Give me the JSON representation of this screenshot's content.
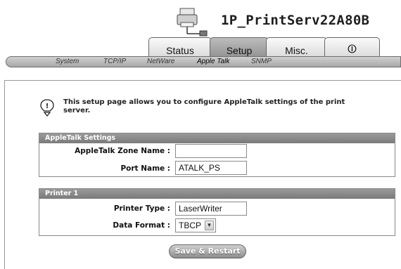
{
  "header": {
    "title": "1P_PrintServ22A80B",
    "icon": "printer-network-icon"
  },
  "tabs": [
    {
      "label": "Status",
      "active": false
    },
    {
      "label": "Setup",
      "active": true
    },
    {
      "label": "Misc.",
      "active": false
    },
    {
      "label": "⏼",
      "icon": "power-icon",
      "active": false
    }
  ],
  "subnav": [
    "System",
    "TCP/IP",
    "NetWare",
    "Apple Talk",
    "SNMP"
  ],
  "subnav_active": "Apple Talk",
  "info": {
    "icon": "info-bulb-icon",
    "text": "This setup page allows you to configure AppleTalk settings of the print server."
  },
  "appletalk_section": {
    "title": "AppleTalk Settings",
    "zone_label": "AppleTalk Zone Name :",
    "zone_value": "",
    "port_label": "Port Name :",
    "port_value": "ATALK_PS"
  },
  "printer_section": {
    "title": "Printer 1",
    "type_label": "Printer Type :",
    "type_value": "LaserWriter",
    "format_label": "Data Format :",
    "format_value": "TBCP"
  },
  "actions": {
    "save_label": "Save & Restart"
  },
  "colors": {
    "section_header": "#8a8a8a",
    "active_tab": "#a5a5a5",
    "subnav": "#bcbcbc"
  }
}
